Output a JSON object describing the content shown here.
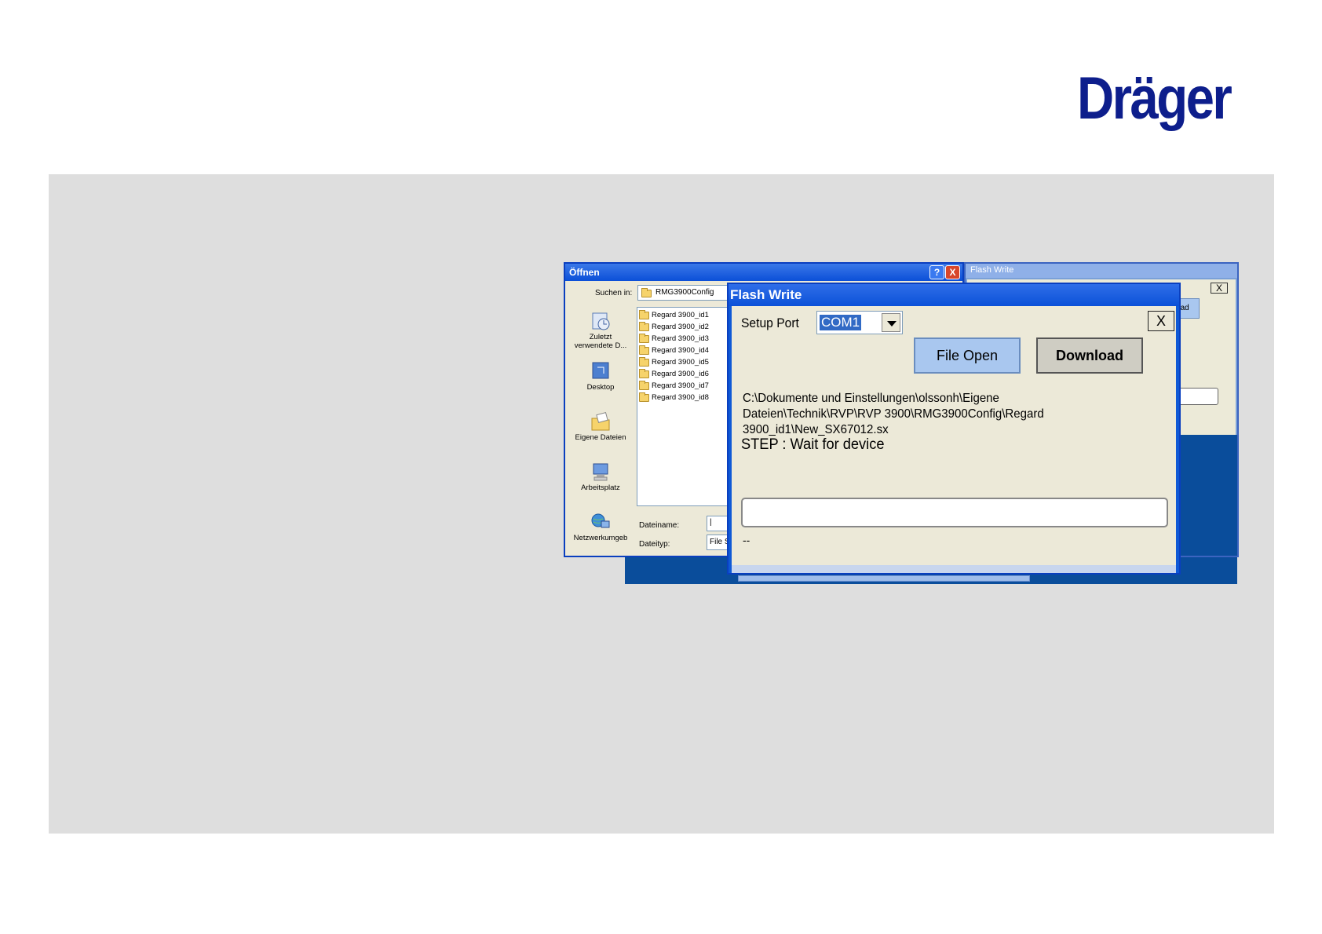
{
  "logo": {
    "text": "Dräger"
  },
  "back_window": {
    "title": "Flash Write",
    "close_glyph": "X",
    "download_partial": "wnload"
  },
  "open_dialog": {
    "title": "Öffnen",
    "help_glyph": "?",
    "close_glyph": "X",
    "look_in_label": "Suchen in:",
    "look_in_value": "RMG3900Config",
    "places": [
      {
        "label": "Zuletzt verwendete D...",
        "icon": "recent-icon"
      },
      {
        "label": "Desktop",
        "icon": "desktop-icon"
      },
      {
        "label": "Eigene Dateien",
        "icon": "my-documents-icon"
      },
      {
        "label": "Arbeitsplatz",
        "icon": "my-computer-icon"
      },
      {
        "label": "Netzwerkumgeb",
        "icon": "network-icon"
      }
    ],
    "files": [
      "Regard 3900_id1",
      "Regard 3900_id2",
      "Regard 3900_id3",
      "Regard 3900_id4",
      "Regard 3900_id5",
      "Regard 3900_id6",
      "Regard 3900_id7",
      "Regard 3900_id8"
    ],
    "filename_label": "Dateiname:",
    "filename_value": "|",
    "filetype_label": "Dateityp:",
    "filetype_value": "File S"
  },
  "flash_write": {
    "title": "Flash Write",
    "setup_port_label": "Setup Port",
    "port_value": "COM1",
    "close_glyph": "X",
    "file_open_label": "File Open",
    "download_label": "Download",
    "path_line1": "C:\\Dokumente und Einstellungen\\olssonh\\Eigene",
    "path_line2": "Dateien\\Technik\\RVP\\RVP 3900\\RMG3900Config\\Regard",
    "path_line3": "3900_id1\\New_SX67012.sx",
    "step_text": "STEP : Wait for device",
    "status_text": "--"
  },
  "colors": {
    "xp_blue": "#0b4fd8",
    "button_blue": "#a9c7ef",
    "dialog_bg": "#ece9d8",
    "logo_blue": "#0d1e8c",
    "slide_gray": "#dedede"
  }
}
